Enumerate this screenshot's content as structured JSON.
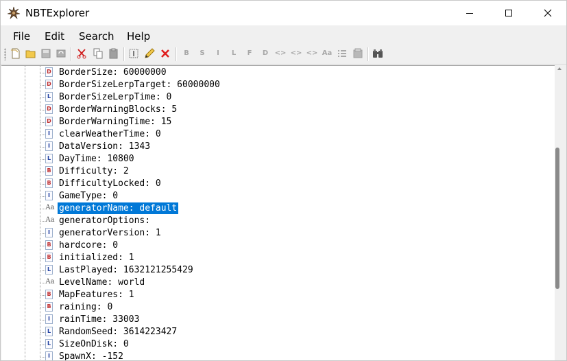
{
  "window": {
    "title": "NBTExplorer"
  },
  "menu": [
    "File",
    "Edit",
    "Search",
    "Help"
  ],
  "toolbar": {
    "buttons": [
      {
        "name": "new-icon"
      },
      {
        "name": "open-folder-icon"
      },
      {
        "name": "save-icon"
      },
      {
        "name": "refresh-icon"
      },
      {
        "name": "cut-icon"
      },
      {
        "name": "copy-icon"
      },
      {
        "name": "paste-icon"
      },
      {
        "name": "rename-icon"
      },
      {
        "name": "edit-pencil-icon"
      },
      {
        "name": "delete-icon"
      },
      {
        "name": "add-byte-tag-icon",
        "glyph": "B"
      },
      {
        "name": "add-short-tag-icon",
        "glyph": "S"
      },
      {
        "name": "add-int-tag-icon",
        "glyph": "I"
      },
      {
        "name": "add-long-tag-icon",
        "glyph": "L"
      },
      {
        "name": "add-float-tag-icon",
        "glyph": "F"
      },
      {
        "name": "add-double-tag-icon",
        "glyph": "D"
      },
      {
        "name": "add-byte-array-icon",
        "glyph": "<>"
      },
      {
        "name": "add-int-array-icon",
        "glyph": "<>"
      },
      {
        "name": "add-long-array-icon",
        "glyph": "<>"
      },
      {
        "name": "add-string-tag-icon",
        "glyph": "Aa"
      },
      {
        "name": "add-list-tag-icon"
      },
      {
        "name": "add-compound-tag-icon"
      },
      {
        "name": "find-icon"
      }
    ],
    "colors": {
      "disabled": "#a8a8a8",
      "delete": "#e02020",
      "cut": "#d02020"
    }
  },
  "tree": {
    "selection_color": "#0078d7",
    "rows": [
      {
        "type": "D",
        "label": "BorderSize: 60000000"
      },
      {
        "type": "D",
        "label": "BorderSizeLerpTarget: 60000000"
      },
      {
        "type": "L",
        "label": "BorderSizeLerpTime: 0"
      },
      {
        "type": "D",
        "label": "BorderWarningBlocks: 5"
      },
      {
        "type": "D",
        "label": "BorderWarningTime: 15"
      },
      {
        "type": "I",
        "label": "clearWeatherTime: 0"
      },
      {
        "type": "I",
        "label": "DataVersion: 1343"
      },
      {
        "type": "L",
        "label": "DayTime: 10800"
      },
      {
        "type": "B",
        "label": "Difficulty: 2"
      },
      {
        "type": "B",
        "label": "DifficultyLocked: 0"
      },
      {
        "type": "I",
        "label": "GameType: 0"
      },
      {
        "type": "Aa",
        "label": "generatorName: default",
        "selected": true
      },
      {
        "type": "Aa",
        "label": "generatorOptions:"
      },
      {
        "type": "I",
        "label": "generatorVersion: 1"
      },
      {
        "type": "B",
        "label": "hardcore: 0"
      },
      {
        "type": "B",
        "label": "initialized: 1"
      },
      {
        "type": "L",
        "label": "LastPlayed: 1632121255429"
      },
      {
        "type": "Aa",
        "label": "LevelName: world"
      },
      {
        "type": "B",
        "label": "MapFeatures: 1"
      },
      {
        "type": "B",
        "label": "raining: 0"
      },
      {
        "type": "I",
        "label": "rainTime: 33003"
      },
      {
        "type": "L",
        "label": "RandomSeed: 3614223427"
      },
      {
        "type": "L",
        "label": "SizeOnDisk: 0"
      },
      {
        "type": "I",
        "label": "SpawnX: -152"
      }
    ]
  },
  "type_colors": {
    "B": "#c03030",
    "D": "#c03030",
    "I": "#2040a0",
    "L": "#2040a0"
  }
}
